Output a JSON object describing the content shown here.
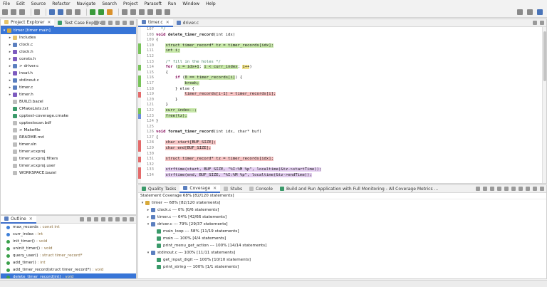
{
  "menu": [
    "File",
    "Edit",
    "Source",
    "Refactor",
    "Navigate",
    "Search",
    "Project",
    "Parasoft",
    "Run",
    "Window",
    "Help"
  ],
  "project_panel": {
    "tabs": [
      {
        "label": "Project Explorer",
        "active": true
      },
      {
        "label": "Test Case Explorer",
        "active": false
      }
    ],
    "tree": [
      {
        "label": "timer [timer main]",
        "depth": 0,
        "expanded": true,
        "icon": "project-icon",
        "selected": true
      },
      {
        "label": "Includes",
        "depth": 1,
        "icon": "folder-icon"
      },
      {
        "label": "clock.c",
        "depth": 1,
        "icon": "c-file-icon"
      },
      {
        "label": "clock.h",
        "depth": 1,
        "icon": "h-file-icon"
      },
      {
        "label": "consts.h",
        "depth": 1,
        "icon": "h-file-icon"
      },
      {
        "label": "> driver.c",
        "depth": 1,
        "icon": "c-file-icon"
      },
      {
        "label": "insat.h",
        "depth": 1,
        "icon": "h-file-icon"
      },
      {
        "label": "stdinout.c",
        "depth": 1,
        "icon": "c-file-icon"
      },
      {
        "label": "timer.c",
        "depth": 1,
        "icon": "c-file-icon"
      },
      {
        "label": "timer.h",
        "depth": 1,
        "icon": "h-file-icon"
      },
      {
        "label": "BUILD.bazel",
        "depth": 1,
        "icon": "file-icon",
        "leaf": true
      },
      {
        "label": "CMakeLists.txt",
        "depth": 1,
        "icon": "cmake-icon",
        "leaf": true
      },
      {
        "label": "cpptest-coverage.cmake",
        "depth": 1,
        "icon": "cmake-icon",
        "leaf": true
      },
      {
        "label": "cpptestscan.bdf",
        "depth": 1,
        "icon": "file-icon",
        "leaf": true
      },
      {
        "label": "> Makefile",
        "depth": 1,
        "icon": "file-icon",
        "leaf": true
      },
      {
        "label": "README.md",
        "depth": 1,
        "icon": "file-icon",
        "leaf": true
      },
      {
        "label": "timer.sln",
        "depth": 1,
        "icon": "file-icon",
        "leaf": true
      },
      {
        "label": "timer.vcxproj",
        "depth": 1,
        "icon": "file-icon",
        "leaf": true
      },
      {
        "label": "timer.vcxproj.filters",
        "depth": 1,
        "icon": "file-icon",
        "leaf": true
      },
      {
        "label": "timer.vcxproj.user",
        "depth": 1,
        "icon": "file-icon",
        "leaf": true
      },
      {
        "label": "WORKSPACE.bazel",
        "depth": 1,
        "icon": "file-icon",
        "leaf": true
      }
    ]
  },
  "outline_panel": {
    "tab": "Outline",
    "items": [
      {
        "name": "max_records",
        "type": ": const int",
        "icon": "blue",
        "prefix": "#"
      },
      {
        "name": "curr_index",
        "type": ": int",
        "icon": "blue"
      },
      {
        "name": "init_timer()",
        "type": ": void",
        "icon": "green"
      },
      {
        "name": "uninit_timer()",
        "type": ": void",
        "icon": "green"
      },
      {
        "name": "query_user()",
        "type": ": struct timer_record*",
        "icon": "green"
      },
      {
        "name": "add_timer()",
        "type": ": int",
        "icon": "green"
      },
      {
        "name": "add_timer_record(struct timer_record*)",
        "type": ": void",
        "icon": "green"
      },
      {
        "name": "delete_timer_record(int)",
        "type": ": void",
        "icon": "green",
        "selected": true
      }
    ]
  },
  "editor": {
    "tabs": [
      {
        "label": "timer.c",
        "active": true
      },
      {
        "label": "driver.c",
        "active": false
      }
    ],
    "lines": [
      {
        "n": "107",
        "segs": [
          {
            "t": "  */",
            "c": "cm"
          }
        ]
      },
      {
        "n": "108",
        "segs": [
          {
            "t": "void ",
            "c": "kw"
          },
          {
            "t": "delete_timer_record",
            "c": "b"
          },
          {
            "t": "(int idx)",
            "c": ""
          }
        ]
      },
      {
        "n": "109",
        "segs": [
          {
            "t": "{",
            "c": ""
          }
        ]
      },
      {
        "n": "110",
        "mk": "green",
        "segs": [
          {
            "t": "    ",
            "c": ""
          },
          {
            "t": "struct timer_record* tz = timer_records[idx];",
            "c": "hl-g"
          }
        ]
      },
      {
        "n": "111",
        "mk": "green",
        "segs": [
          {
            "t": "    ",
            "c": ""
          },
          {
            "t": "int i;",
            "c": "hl-g"
          }
        ]
      },
      {
        "n": "112",
        "segs": [
          {
            "t": "",
            "c": ""
          }
        ]
      },
      {
        "n": "113",
        "segs": [
          {
            "t": "    /* fill in the holes */",
            "c": "cm"
          }
        ]
      },
      {
        "n": "114",
        "mk": "green",
        "segs": [
          {
            "t": "    ",
            "c": ""
          },
          {
            "t": "for ",
            "c": "kw"
          },
          {
            "t": "(",
            "c": ""
          },
          {
            "t": "i = idx+1",
            "c": "hl-g"
          },
          {
            "t": "; ",
            "c": ""
          },
          {
            "t": "i < curr_index",
            "c": "hl-g"
          },
          {
            "t": "; ",
            "c": ""
          },
          {
            "t": "i++",
            "c": "hl-y"
          },
          {
            "t": ")",
            "c": ""
          }
        ]
      },
      {
        "n": "115",
        "segs": [
          {
            "t": "    {",
            "c": ""
          }
        ]
      },
      {
        "n": "116",
        "mk": "green",
        "segs": [
          {
            "t": "        ",
            "c": ""
          },
          {
            "t": "if ",
            "c": "kw"
          },
          {
            "t": "(",
            "c": ""
          },
          {
            "t": "0 == timer_records[i]",
            "c": "hl-g"
          },
          {
            "t": ") {",
            "c": ""
          }
        ]
      },
      {
        "n": "117",
        "mk": "green",
        "segs": [
          {
            "t": "            ",
            "c": ""
          },
          {
            "t": "break;",
            "c": "hl-g"
          }
        ]
      },
      {
        "n": "118",
        "segs": [
          {
            "t": "        } else {",
            "c": ""
          }
        ]
      },
      {
        "n": "119",
        "mk": "red",
        "segs": [
          {
            "t": "            ",
            "c": ""
          },
          {
            "t": "timer_records[i-1] = timer_records[i];",
            "c": "hl-r"
          }
        ]
      },
      {
        "n": "120",
        "segs": [
          {
            "t": "        }",
            "c": ""
          }
        ]
      },
      {
        "n": "121",
        "segs": [
          {
            "t": "    }",
            "c": ""
          }
        ]
      },
      {
        "n": "122",
        "mk": "green",
        "segs": [
          {
            "t": "    ",
            "c": ""
          },
          {
            "t": "curr_index--;",
            "c": "hl-g"
          }
        ]
      },
      {
        "n": "123",
        "mk": "blue",
        "segs": [
          {
            "t": "    ",
            "c": ""
          },
          {
            "t": "free(tz);",
            "c": "hl-g"
          }
        ]
      },
      {
        "n": "124",
        "segs": [
          {
            "t": "}",
            "c": ""
          }
        ]
      },
      {
        "n": "125",
        "segs": [
          {
            "t": "",
            "c": ""
          }
        ]
      },
      {
        "n": "126",
        "segs": [
          {
            "t": "void ",
            "c": "kw"
          },
          {
            "t": "format_timer_record",
            "c": "b"
          },
          {
            "t": "(int idx, char* buf)",
            "c": ""
          }
        ]
      },
      {
        "n": "127",
        "segs": [
          {
            "t": "{",
            "c": ""
          }
        ]
      },
      {
        "n": "128",
        "mk": "red",
        "segs": [
          {
            "t": "    ",
            "c": ""
          },
          {
            "t": "char start[BUF_SIZE];",
            "c": "hl-r"
          }
        ]
      },
      {
        "n": "129",
        "mk": "red",
        "segs": [
          {
            "t": "    ",
            "c": ""
          },
          {
            "t": "char end[BUF_SIZE];",
            "c": "hl-r"
          }
        ]
      },
      {
        "n": "130",
        "segs": [
          {
            "t": "",
            "c": ""
          }
        ]
      },
      {
        "n": "131",
        "mk": "red",
        "segs": [
          {
            "t": "    ",
            "c": ""
          },
          {
            "t": "struct timer_record* tz = timer_records[idx];",
            "c": "hl-r"
          }
        ]
      },
      {
        "n": "132",
        "segs": [
          {
            "t": "",
            "c": ""
          }
        ]
      },
      {
        "n": "133",
        "mk": "red",
        "segs": [
          {
            "t": "    ",
            "c": ""
          },
          {
            "t": "strftime(start, BUF_SIZE, \"%I:%M %p\", localtime(&tz->startTime));",
            "c": "hl-p"
          }
        ]
      },
      {
        "n": "134",
        "mk": "red",
        "segs": [
          {
            "t": "    ",
            "c": ""
          },
          {
            "t": "strftime(end, BUF_SIZE, \"%I:%M %p\", localtime(&tz->endTime));",
            "c": "hl-p"
          }
        ]
      }
    ]
  },
  "bottom_panel": {
    "tabs": [
      {
        "label": "Quality Tasks",
        "active": false
      },
      {
        "label": "Coverage",
        "active": true
      },
      {
        "label": "Stubs",
        "active": false
      },
      {
        "label": "Console",
        "active": false
      },
      {
        "label": "Build and Run Application with Full Monitoring - All Coverage Metrics ...",
        "active": false
      }
    ],
    "summary": "Statement Coverage 68% [82/120 statements]",
    "rows": [
      {
        "label": "timer --- 68% [82/120 statements]",
        "depth": 0,
        "arrow": "▾",
        "icon": "project-icon"
      },
      {
        "label": "clock.c --- 0% [0/6 statements]",
        "depth": 1,
        "arrow": "▸",
        "icon": "c-file-icon"
      },
      {
        "label": "timer.c --- 64% [42/66 statements]",
        "depth": 1,
        "arrow": "▸",
        "icon": "c-file-icon"
      },
      {
        "label": "driver.c --- 79% [29/37 statements]",
        "depth": 1,
        "arrow": "▾",
        "icon": "c-file-icon"
      },
      {
        "label": "main_loop --- 58% [11/19 statements]",
        "depth": 2,
        "arrow": "",
        "icon": "function-icon"
      },
      {
        "label": "main --- 100% [4/4 statements]",
        "depth": 2,
        "arrow": "",
        "icon": "function-icon"
      },
      {
        "label": "print_menu_get_action --- 100% [14/14 statements]",
        "depth": 2,
        "arrow": "",
        "icon": "function-icon"
      },
      {
        "label": "stdinout.c --- 100% [11/11 statements]",
        "depth": 1,
        "arrow": "▾",
        "icon": "c-file-icon"
      },
      {
        "label": "get_input_digit --- 100% [10/10 statements]",
        "depth": 2,
        "arrow": "",
        "icon": "function-icon"
      },
      {
        "label": "print_string --- 100% [1/1 statements]",
        "depth": 2,
        "arrow": "",
        "icon": "function-icon"
      }
    ]
  }
}
